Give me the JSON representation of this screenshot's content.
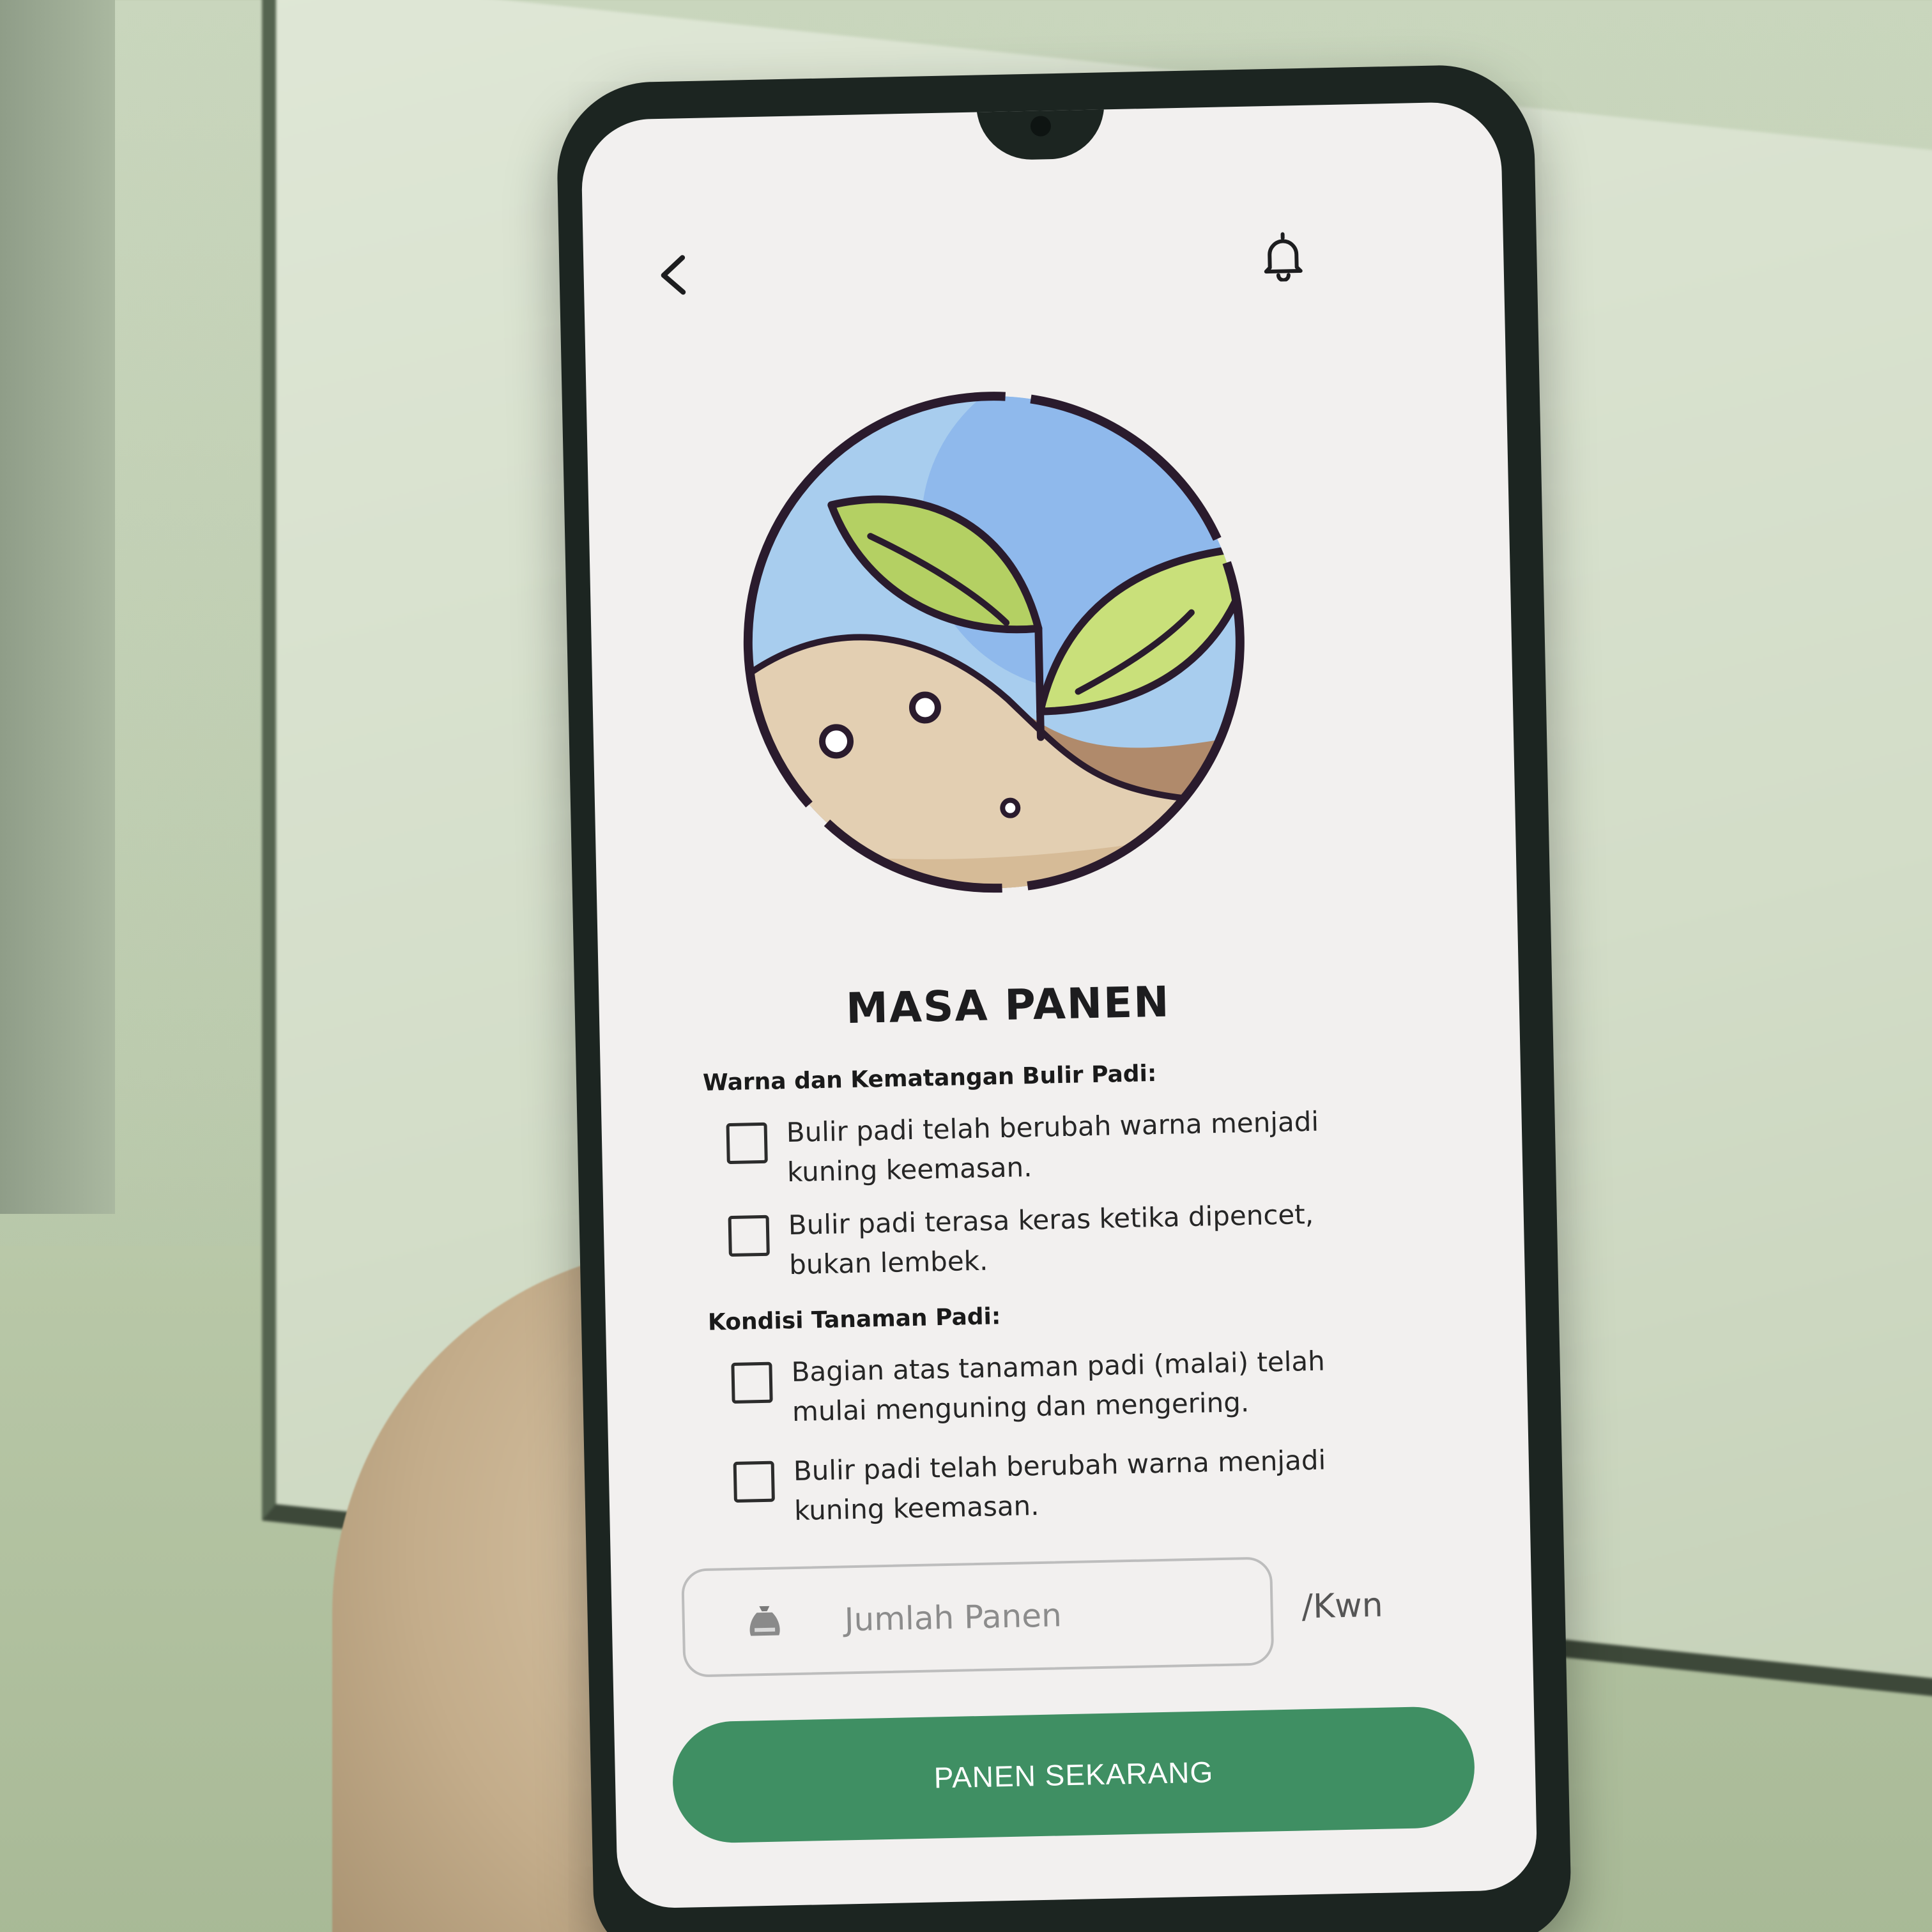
{
  "screen": {
    "title": "MASA PANEN",
    "icons": {
      "back": "chevron-left-icon",
      "notification": "bell-icon",
      "field": "rice-sack-icon",
      "illustration": "sprout-field-illustration"
    },
    "sections": [
      {
        "label": "Warna dan Kematangan Bulir Padi:",
        "items": [
          {
            "text": "Bulir padi telah berubah warna menjadi kuning keemasan.",
            "checked": false
          },
          {
            "text": "Bulir padi terasa keras ketika dipencet, bukan lembek.",
            "checked": false
          }
        ]
      },
      {
        "label": "Kondisi Tanaman Padi:",
        "items": [
          {
            "text": "Bagian atas tanaman padi (malai) telah mulai menguning dan mengering.",
            "checked": false
          },
          {
            "text": "Bulir padi telah berubah warna menjadi kuning keemasan.",
            "checked": false
          }
        ]
      }
    ],
    "harvest_input": {
      "placeholder": "Jumlah Panen",
      "unit": "/Kwn"
    },
    "submit_label": "PANEN SEKARANG"
  },
  "colors": {
    "primary": "#3f8f63",
    "screen_bg": "#f2f0ef",
    "text": "#1d1d1f"
  }
}
